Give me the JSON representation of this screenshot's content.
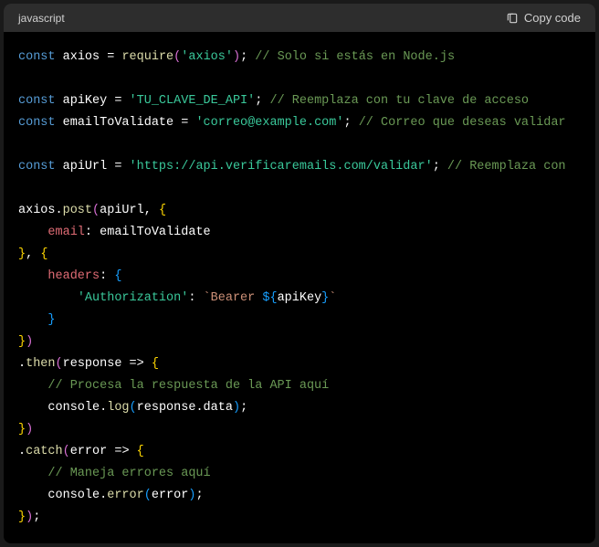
{
  "header": {
    "language": "javascript",
    "copy_label": "Copy code"
  },
  "code": {
    "line1": {
      "kw": "const",
      "var": " axios ",
      "op": "= ",
      "fn": "require",
      "str": "'axios'",
      "cmt": " // Solo si estás en Node.js"
    },
    "line2": {
      "kw": "const",
      "var": " apiKey ",
      "op": "= ",
      "str": "'TU_CLAVE_DE_API'",
      "cmt": " // Reemplaza con tu clave de acceso"
    },
    "line3": {
      "kw": "const",
      "var": " emailToValidate ",
      "op": "= ",
      "str": "'correo@example.com'",
      "cmt": " // Correo que deseas validar"
    },
    "line4": {
      "kw": "const",
      "var": " apiUrl ",
      "op": "= ",
      "str": "'https://api.verificaremails.com/validar'",
      "cmt": " // Reemplaza con "
    },
    "line5": {
      "obj": "axios.",
      "fn": "post",
      "args": "(apiUrl, {"
    },
    "line6": {
      "prop": "email",
      "val": ": emailToValidate"
    },
    "line7": {
      "close": "}, {"
    },
    "line8": {
      "prop": "headers",
      "val": ": {"
    },
    "line9": {
      "key": "'Authorization'",
      "val": ": ",
      "tpl": "`Bearer ${apiKey}`"
    },
    "line10": {
      "close": "    }"
    },
    "line11": {
      "close": "})"
    },
    "line12": {
      "fn": ".then",
      "args": "(response => {"
    },
    "line13": {
      "cmt": "    // Procesa la respuesta de la API aquí"
    },
    "line14": {
      "obj": "    console.",
      "fn": "log",
      "args": "(response.data);"
    },
    "line15": {
      "close": "})"
    },
    "line16": {
      "fn": ".catch",
      "args": "(error => {"
    },
    "line17": {
      "cmt": "    // Maneja errores aquí"
    },
    "line18": {
      "obj": "    console.",
      "fn": "error",
      "args": "(error);"
    },
    "line19": {
      "close": "});"
    }
  }
}
